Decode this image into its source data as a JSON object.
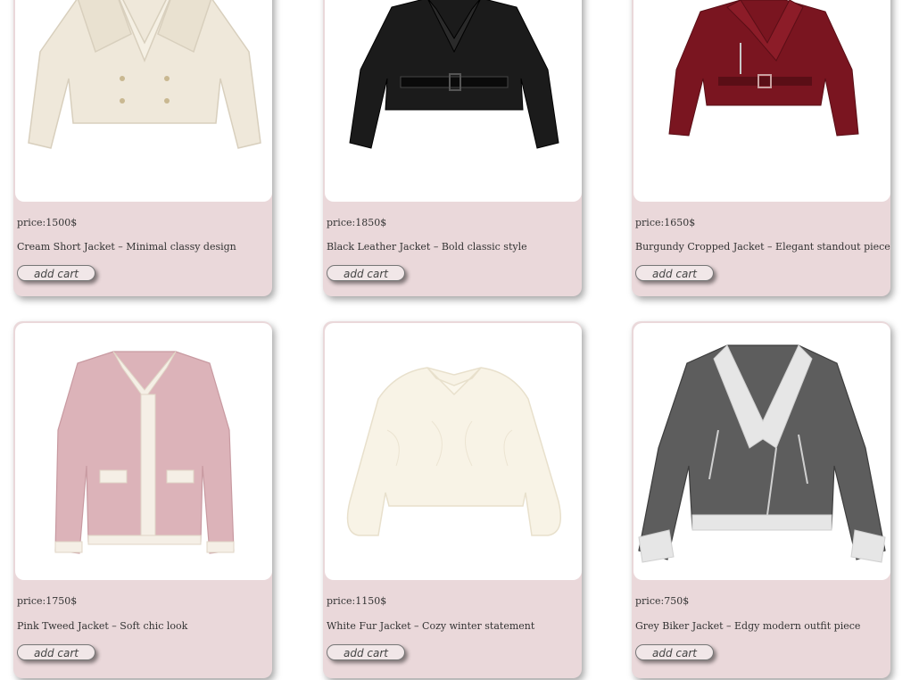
{
  "products": [
    {
      "price": "price:1500$",
      "description": "Cream Short Jacket – Minimal classy design",
      "button": "add cart",
      "color": "#efe8da",
      "image": "cream-short-jacket-image"
    },
    {
      "price": "price:1850$",
      "description": "Black Leather Jacket – Bold classic style",
      "button": "add cart",
      "color": "#1b1b1b",
      "image": "black-leather-jacket-image"
    },
    {
      "price": "price:1650$",
      "description": "Burgundy Cropped Jacket – Elegant standout piece",
      "button": "add cart",
      "color": "#7a1520",
      "image": "burgundy-cropped-jacket-image"
    },
    {
      "price": "price:1750$",
      "description": "Pink Tweed Jacket – Soft chic look",
      "button": "add cart",
      "color": "#dcb3b9",
      "image": "pink-tweed-jacket-image"
    },
    {
      "price": "price:1150$",
      "description": "White Fur Jacket – Cozy winter statement",
      "button": "add cart",
      "color": "#f8f3e6",
      "image": "white-fur-jacket-image"
    },
    {
      "price": "price:750$",
      "description": "Grey Biker Jacket – Edgy modern outfit piece",
      "button": "add cart",
      "color": "#5d5d5d",
      "image": "grey-biker-jacket-image"
    }
  ]
}
